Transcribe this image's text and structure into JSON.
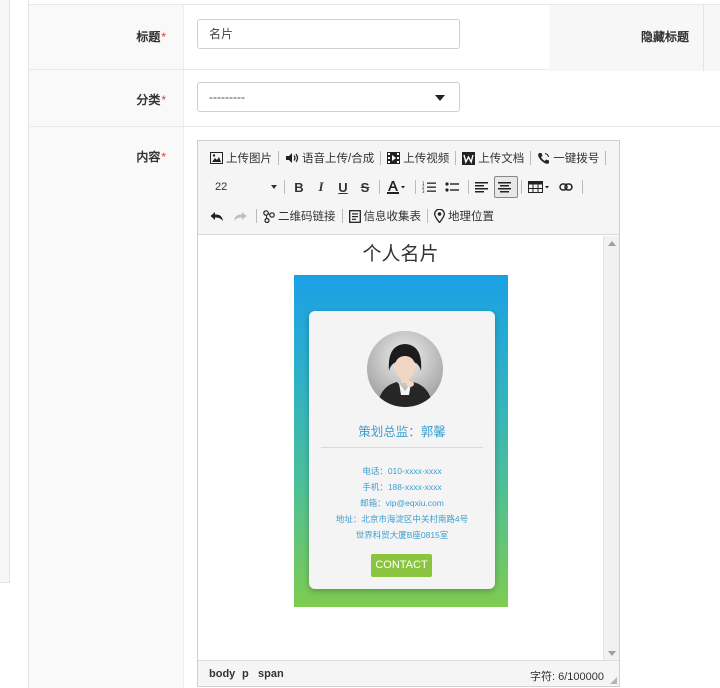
{
  "form": {
    "title_label": "标题",
    "required_mark": "*",
    "title_value": "名片",
    "hidden_title_label": "隐藏标题",
    "category_label": "分类",
    "category_selected": "---------",
    "content_label": "内容"
  },
  "toolbar": {
    "upload_image": "上传图片",
    "voice_upload": "语音上传/合成",
    "upload_video": "上传视频",
    "upload_doc": "上传文档",
    "one_click_dial": "一键拨号",
    "font_size": "22",
    "qr_link": "二维码链接",
    "info_form": "信息收集表",
    "location": "地理位置"
  },
  "document": {
    "heading": "个人名片",
    "role": "策划总监：郭馨",
    "phone": "电话：010-xxxx-xxxx",
    "mobile": "手机：188-xxxx-xxxx",
    "email": "邮箱：vip@eqxiu.com",
    "address_line1": "地址：北京市海淀区中关村南路4号",
    "address_line2": "世界科贸大厦B座0815室",
    "contact_button": "CONTACT"
  },
  "statusbar": {
    "path": [
      "body",
      "p",
      "span"
    ],
    "word_count": "字符: 6/100000"
  },
  "colors": {
    "required": "#e4393c",
    "card_text": "#3d9fd0",
    "contact_button": "#8bc540",
    "gradient_top": "#1aa0e6",
    "gradient_bottom": "#7ecb50"
  }
}
